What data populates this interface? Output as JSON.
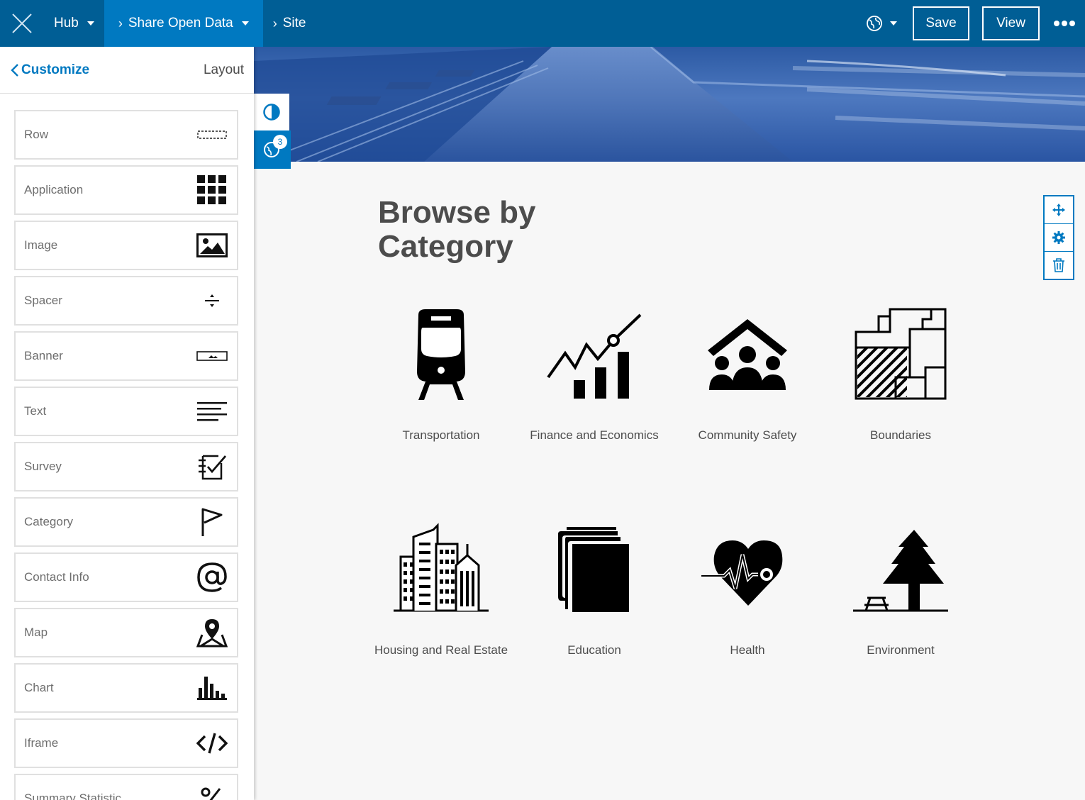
{
  "topbar": {
    "crumbs": [
      {
        "label": "Hub"
      },
      {
        "label": "Share Open Data"
      },
      {
        "label": "Site"
      }
    ],
    "save_label": "Save",
    "view_label": "View",
    "brand_color": "#005e95",
    "active_color": "#0079c1"
  },
  "sidebar": {
    "back_label": "Customize",
    "panel_label": "Layout",
    "cards": [
      {
        "label": "Row",
        "icon": "row-icon"
      },
      {
        "label": "Application",
        "icon": "grid-icon"
      },
      {
        "label": "Image",
        "icon": "image-icon"
      },
      {
        "label": "Spacer",
        "icon": "spacer-icon"
      },
      {
        "label": "Banner",
        "icon": "banner-icon"
      },
      {
        "label": "Text",
        "icon": "text-lines-icon"
      },
      {
        "label": "Survey",
        "icon": "survey-icon"
      },
      {
        "label": "Category",
        "icon": "flag-icon"
      },
      {
        "label": "Contact Info",
        "icon": "at-icon"
      },
      {
        "label": "Map",
        "icon": "map-pin-icon"
      },
      {
        "label": "Chart",
        "icon": "bar-chart-icon"
      },
      {
        "label": "Iframe",
        "icon": "code-icon"
      },
      {
        "label": "Summary Statistic",
        "icon": "percent-icon"
      }
    ]
  },
  "float_tools": {
    "badge_count": "3"
  },
  "main": {
    "title": "Browse by Category",
    "categories": [
      {
        "label": "Transportation",
        "icon": "train-icon"
      },
      {
        "label": "Finance and Economics",
        "icon": "finance-chart-icon"
      },
      {
        "label": "Community Safety",
        "icon": "community-icon"
      },
      {
        "label": "Boundaries",
        "icon": "boundaries-icon"
      },
      {
        "label": "Housing and Real Estate",
        "icon": "buildings-icon"
      },
      {
        "label": "Education",
        "icon": "books-icon"
      },
      {
        "label": "Health",
        "icon": "heart-pulse-icon"
      },
      {
        "label": "Environment",
        "icon": "tree-icon"
      }
    ]
  }
}
